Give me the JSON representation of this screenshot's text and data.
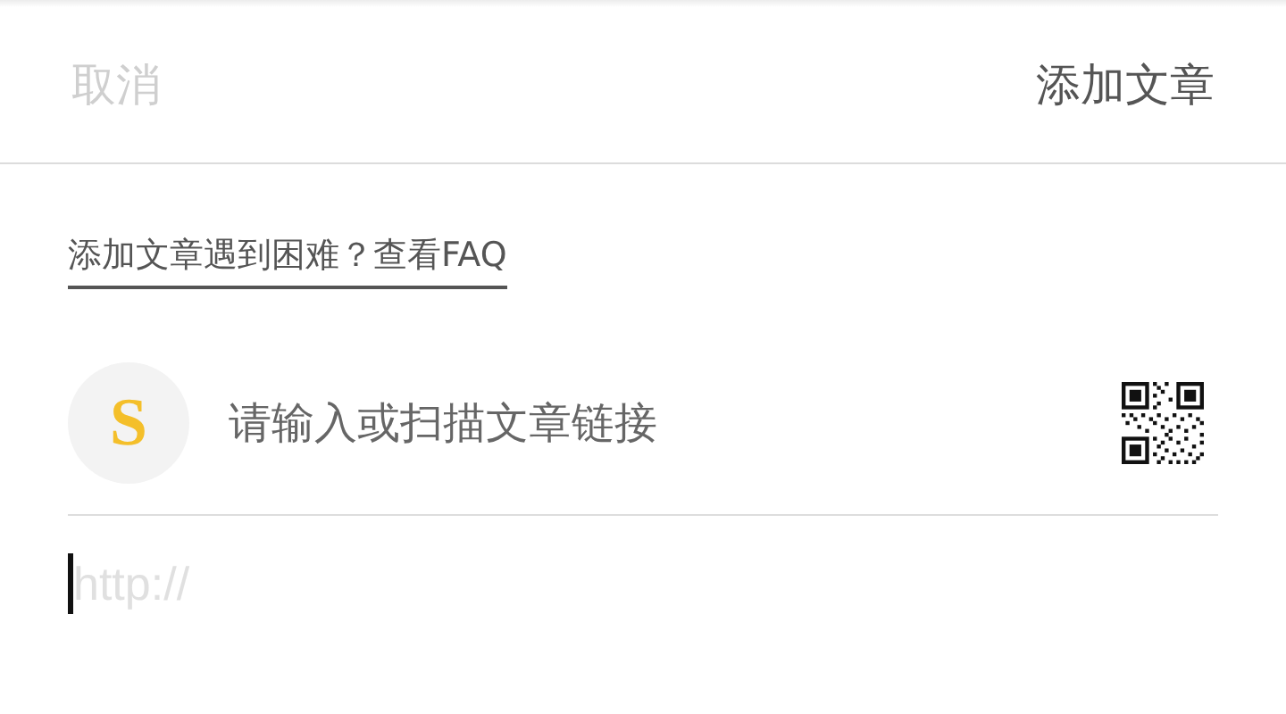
{
  "header": {
    "cancel": {
      "label": "取消",
      "disabled": true
    },
    "title": "添加文章"
  },
  "help_link": "添加文章遇到困难？查看FAQ",
  "source": {
    "logo_letter": "S",
    "prompt": "请输入或扫描文章链接"
  },
  "url_field": {
    "placeholder": "http://"
  }
}
